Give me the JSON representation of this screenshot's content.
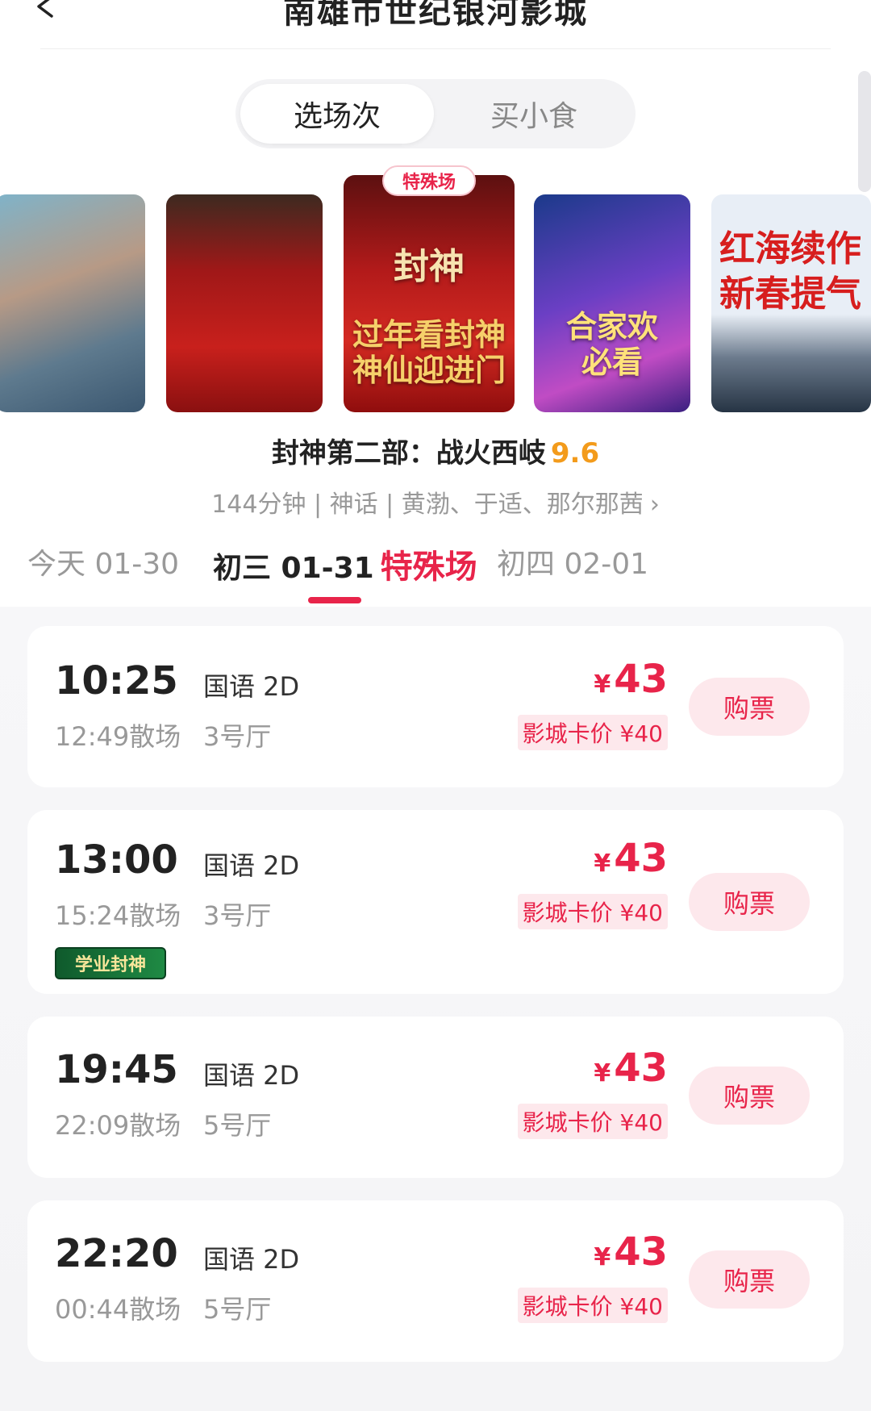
{
  "header": {
    "title": "南雄市世纪银河影城"
  },
  "segment": {
    "tabs": [
      {
        "label": "选场次"
      },
      {
        "label": "买小食"
      }
    ]
  },
  "posters": {
    "special_badge": "特殊场",
    "items": [
      {
        "text": ""
      },
      {
        "text": ""
      },
      {
        "text": "过年看封神\n神仙迎进门",
        "title_text": "封神"
      },
      {
        "text": "合家欢\n必看"
      },
      {
        "text": "红海续作\n新春提气"
      }
    ]
  },
  "movie": {
    "title": "封神第二部：战火西岐",
    "score": "9.6",
    "meta": "144分钟 | 神话 | 黄渤、于适、那尔那茜"
  },
  "dates": [
    {
      "label": "今天 01-30"
    },
    {
      "label": "初三 01-31",
      "tag": "特殊场"
    },
    {
      "label": "初四 02-01"
    }
  ],
  "showtimes": [
    {
      "start": "10:25",
      "end": "12:49散场",
      "lang": "国语 2D",
      "hall": "3号厅",
      "currency": "¥",
      "price": "43",
      "card_price": "影城卡价 ¥40",
      "buy": "购票"
    },
    {
      "start": "13:00",
      "end": "15:24散场",
      "lang": "国语 2D",
      "hall": "3号厅",
      "currency": "¥",
      "price": "43",
      "card_price": "影城卡价 ¥40",
      "buy": "购票",
      "promo": "学业封神"
    },
    {
      "start": "19:45",
      "end": "22:09散场",
      "lang": "国语 2D",
      "hall": "5号厅",
      "currency": "¥",
      "price": "43",
      "card_price": "影城卡价 ¥40",
      "buy": "购票"
    },
    {
      "start": "22:20",
      "end": "00:44散场",
      "lang": "国语 2D",
      "hall": "5号厅",
      "currency": "¥",
      "price": "43",
      "card_price": "影城卡价 ¥40",
      "buy": "购票"
    }
  ],
  "colors": {
    "accent": "#e8244a",
    "score": "#f39b1b",
    "muted": "#999999"
  }
}
